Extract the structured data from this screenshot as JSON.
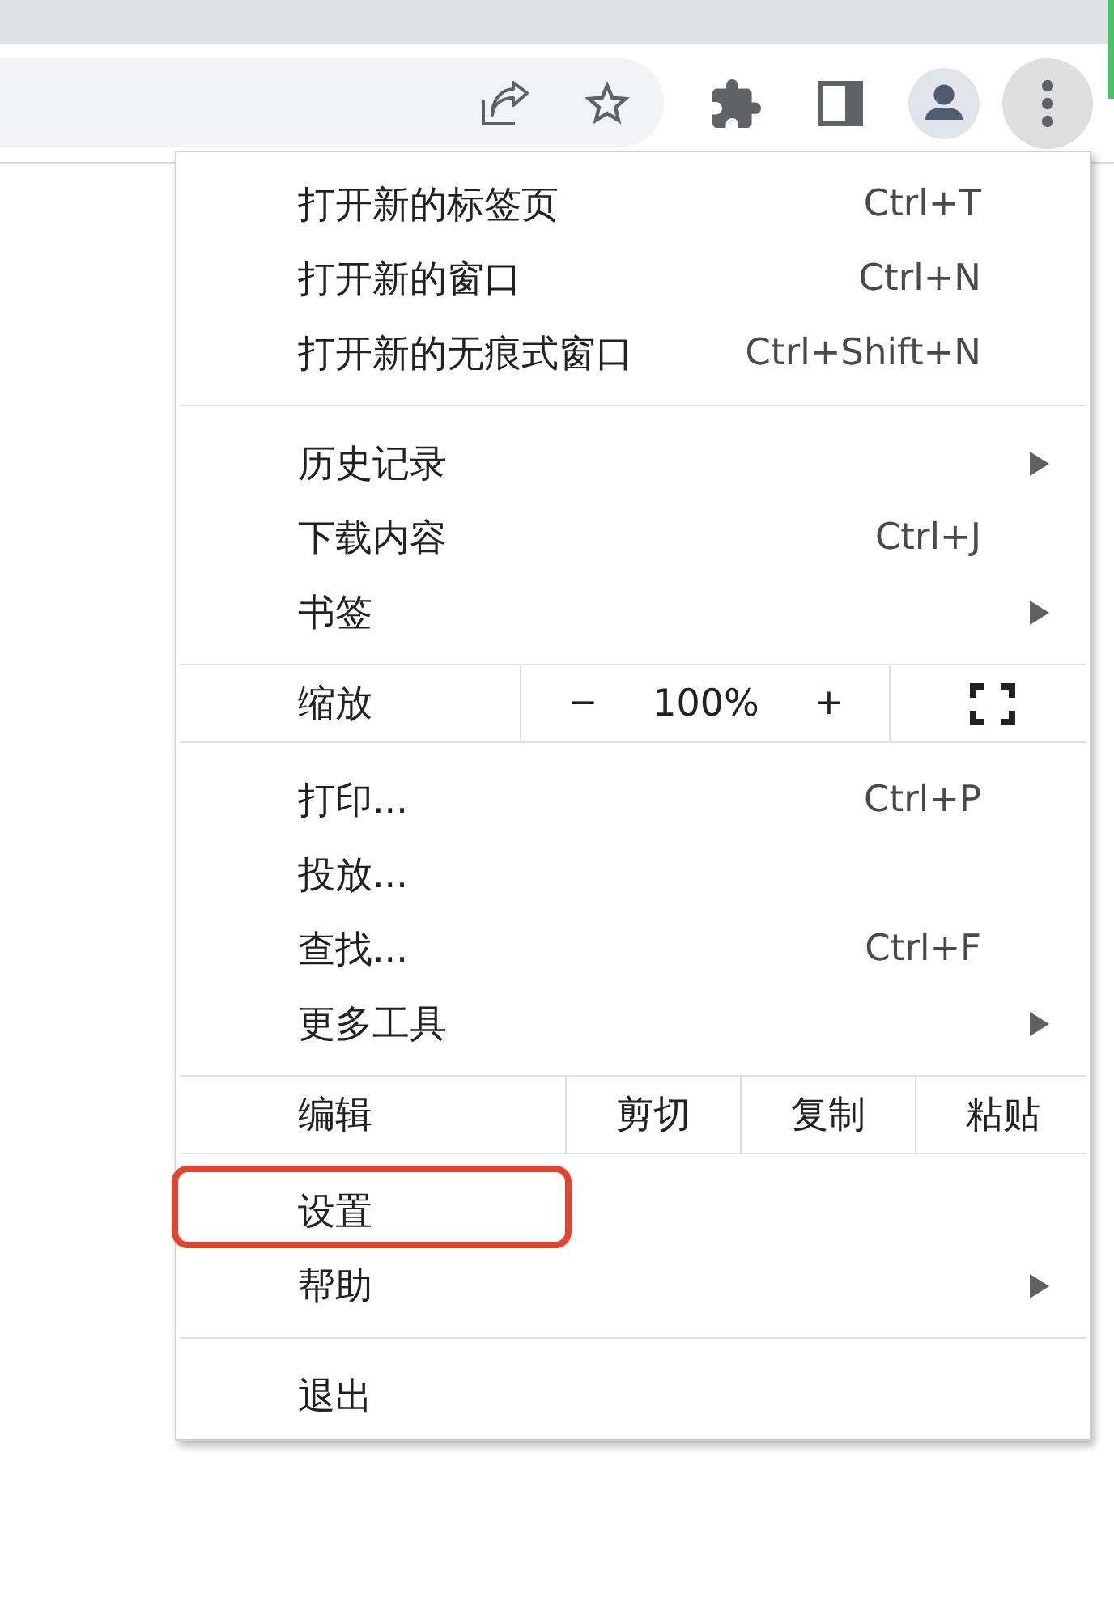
{
  "toolbar": {
    "menu_button_active": true
  },
  "menu": {
    "sections": [
      {
        "kind": "items",
        "items": [
          {
            "label": "打开新的标签页",
            "shortcut": "Ctrl+T",
            "submenu": false,
            "highlighted": false
          },
          {
            "label": "打开新的窗口",
            "shortcut": "Ctrl+N",
            "submenu": false,
            "highlighted": false
          },
          {
            "label": "打开新的无痕式窗口",
            "shortcut": "Ctrl+Shift+N",
            "submenu": false,
            "highlighted": false
          }
        ]
      },
      {
        "kind": "items",
        "items": [
          {
            "label": "历史记录",
            "submenu": true,
            "highlighted": false
          },
          {
            "label": "下载内容",
            "shortcut": "Ctrl+J",
            "submenu": false,
            "highlighted": false
          },
          {
            "label": "书签",
            "submenu": true,
            "highlighted": false
          }
        ]
      },
      {
        "kind": "zoom",
        "label": "缩放",
        "decrease": "−",
        "value": "100%",
        "increase": "+"
      },
      {
        "kind": "items",
        "items": [
          {
            "label": "打印...",
            "shortcut": "Ctrl+P",
            "submenu": false,
            "highlighted": false
          },
          {
            "label": "投放...",
            "submenu": false,
            "highlighted": false
          },
          {
            "label": "查找...",
            "shortcut": "Ctrl+F",
            "submenu": false,
            "highlighted": false
          },
          {
            "label": "更多工具",
            "submenu": true,
            "highlighted": false
          }
        ]
      },
      {
        "kind": "edit",
        "label": "编辑",
        "actions": [
          "剪切",
          "复制",
          "粘贴"
        ]
      },
      {
        "kind": "items",
        "items": [
          {
            "label": "设置",
            "submenu": false,
            "highlighted": true
          },
          {
            "label": "帮助",
            "submenu": true,
            "highlighted": false
          }
        ]
      },
      {
        "kind": "items",
        "items": [
          {
            "label": "退出",
            "submenu": false,
            "highlighted": false
          }
        ]
      }
    ]
  }
}
